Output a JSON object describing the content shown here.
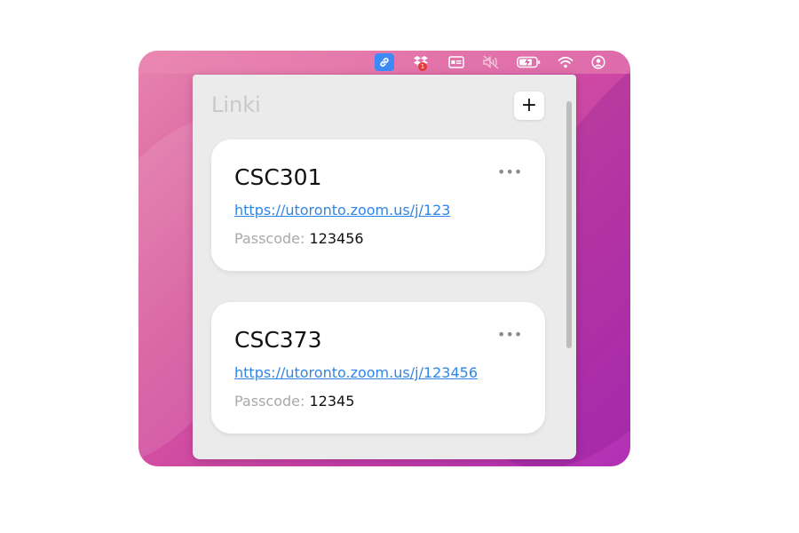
{
  "menubar": {
    "icons": [
      "link-icon",
      "dropbox-icon",
      "card-icon",
      "mute-icon",
      "battery-charging-icon",
      "wifi-icon",
      "user-circle-icon"
    ],
    "dropbox_badge": "1"
  },
  "app": {
    "title": "Linki",
    "add_label": "+"
  },
  "cards": [
    {
      "title": "CSC301",
      "more_label": "•••",
      "link": "https://utoronto.zoom.us/j/123",
      "passcode_label": "Passcode:",
      "passcode": "123456"
    },
    {
      "title": "CSC373",
      "more_label": "•••",
      "link": "https://utoronto.zoom.us/j/123456",
      "passcode_label": "Passcode:",
      "passcode": "12345"
    }
  ],
  "colors": {
    "accent_link": "#2e86e8",
    "menubar_active": "#3d8af7",
    "wallpaper": "#d6579c"
  }
}
